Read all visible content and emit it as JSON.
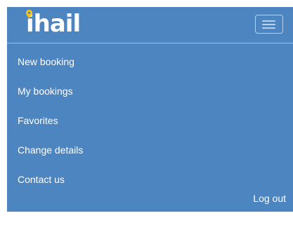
{
  "brand": {
    "logo_text": "ihail",
    "logo_color": "#ffffff",
    "pin_color": "#f5c518"
  },
  "header": {
    "background": "#4c85c0",
    "menu_icon": "hamburger-menu-icon"
  },
  "nav": {
    "items": [
      {
        "label": "New booking"
      },
      {
        "label": "My bookings"
      },
      {
        "label": "Favorites"
      },
      {
        "label": "Change details"
      },
      {
        "label": "Contact us"
      }
    ]
  },
  "footer": {
    "logout_label": "Log out"
  }
}
